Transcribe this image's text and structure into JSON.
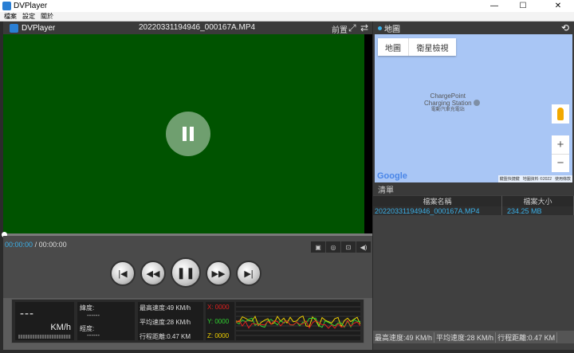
{
  "window": {
    "title": "DVPlayer",
    "minimize": "—",
    "maximize": "☐",
    "close": "✕"
  },
  "menu": [
    "檔案",
    "設定",
    "關於"
  ],
  "player": {
    "brand": "DVPlayer",
    "filename": "20220331194946_000167A.MP4",
    "camera": "前置",
    "current_time": "00:00:00",
    "separator": "/",
    "total_time": "00:00:00",
    "seek_progress": 0
  },
  "stats": {
    "speed": "---",
    "speed_unit": "KM/h",
    "latitude_label": "緯度:",
    "latitude_value": "------",
    "longitude_label": "經度:",
    "longitude_value": "------",
    "max_speed": "最高速度:49 KM/h",
    "avg_speed": "平均速度:28 KM/h",
    "distance": "行程距離:0.47 KM",
    "x_label": "X: 0000",
    "y_label": "Y: 0000",
    "z_label": "Z: 0000",
    "colors": {
      "x": "#e02020",
      "y": "#30d030",
      "z": "#f0d000"
    }
  },
  "map": {
    "title": "地圖",
    "tab_map": "地圖",
    "tab_satellite": "衛星檢視",
    "poi_name_1": "ChargePoint",
    "poi_name_2": "Charging Station",
    "poi_sub": "電動汽車充電站",
    "zoom_in": "+",
    "zoom_out": "−",
    "google": "Google",
    "attr_shortcuts": "鍵盤快捷鍵",
    "attr_data": "地圖資料 ©2022",
    "attr_terms": "使用條款"
  },
  "list": {
    "title": "清單",
    "col_name": "檔案名稱",
    "col_size": "檔案大小",
    "rows": [
      {
        "name": "20220331194946_000167A.MP4",
        "size": "234.25 MB"
      }
    ],
    "foot_max": "最高速度:49 KM/h",
    "foot_avg": "平均速度:28 KM/h",
    "foot_dist": "行程距離:0.47 KM"
  }
}
